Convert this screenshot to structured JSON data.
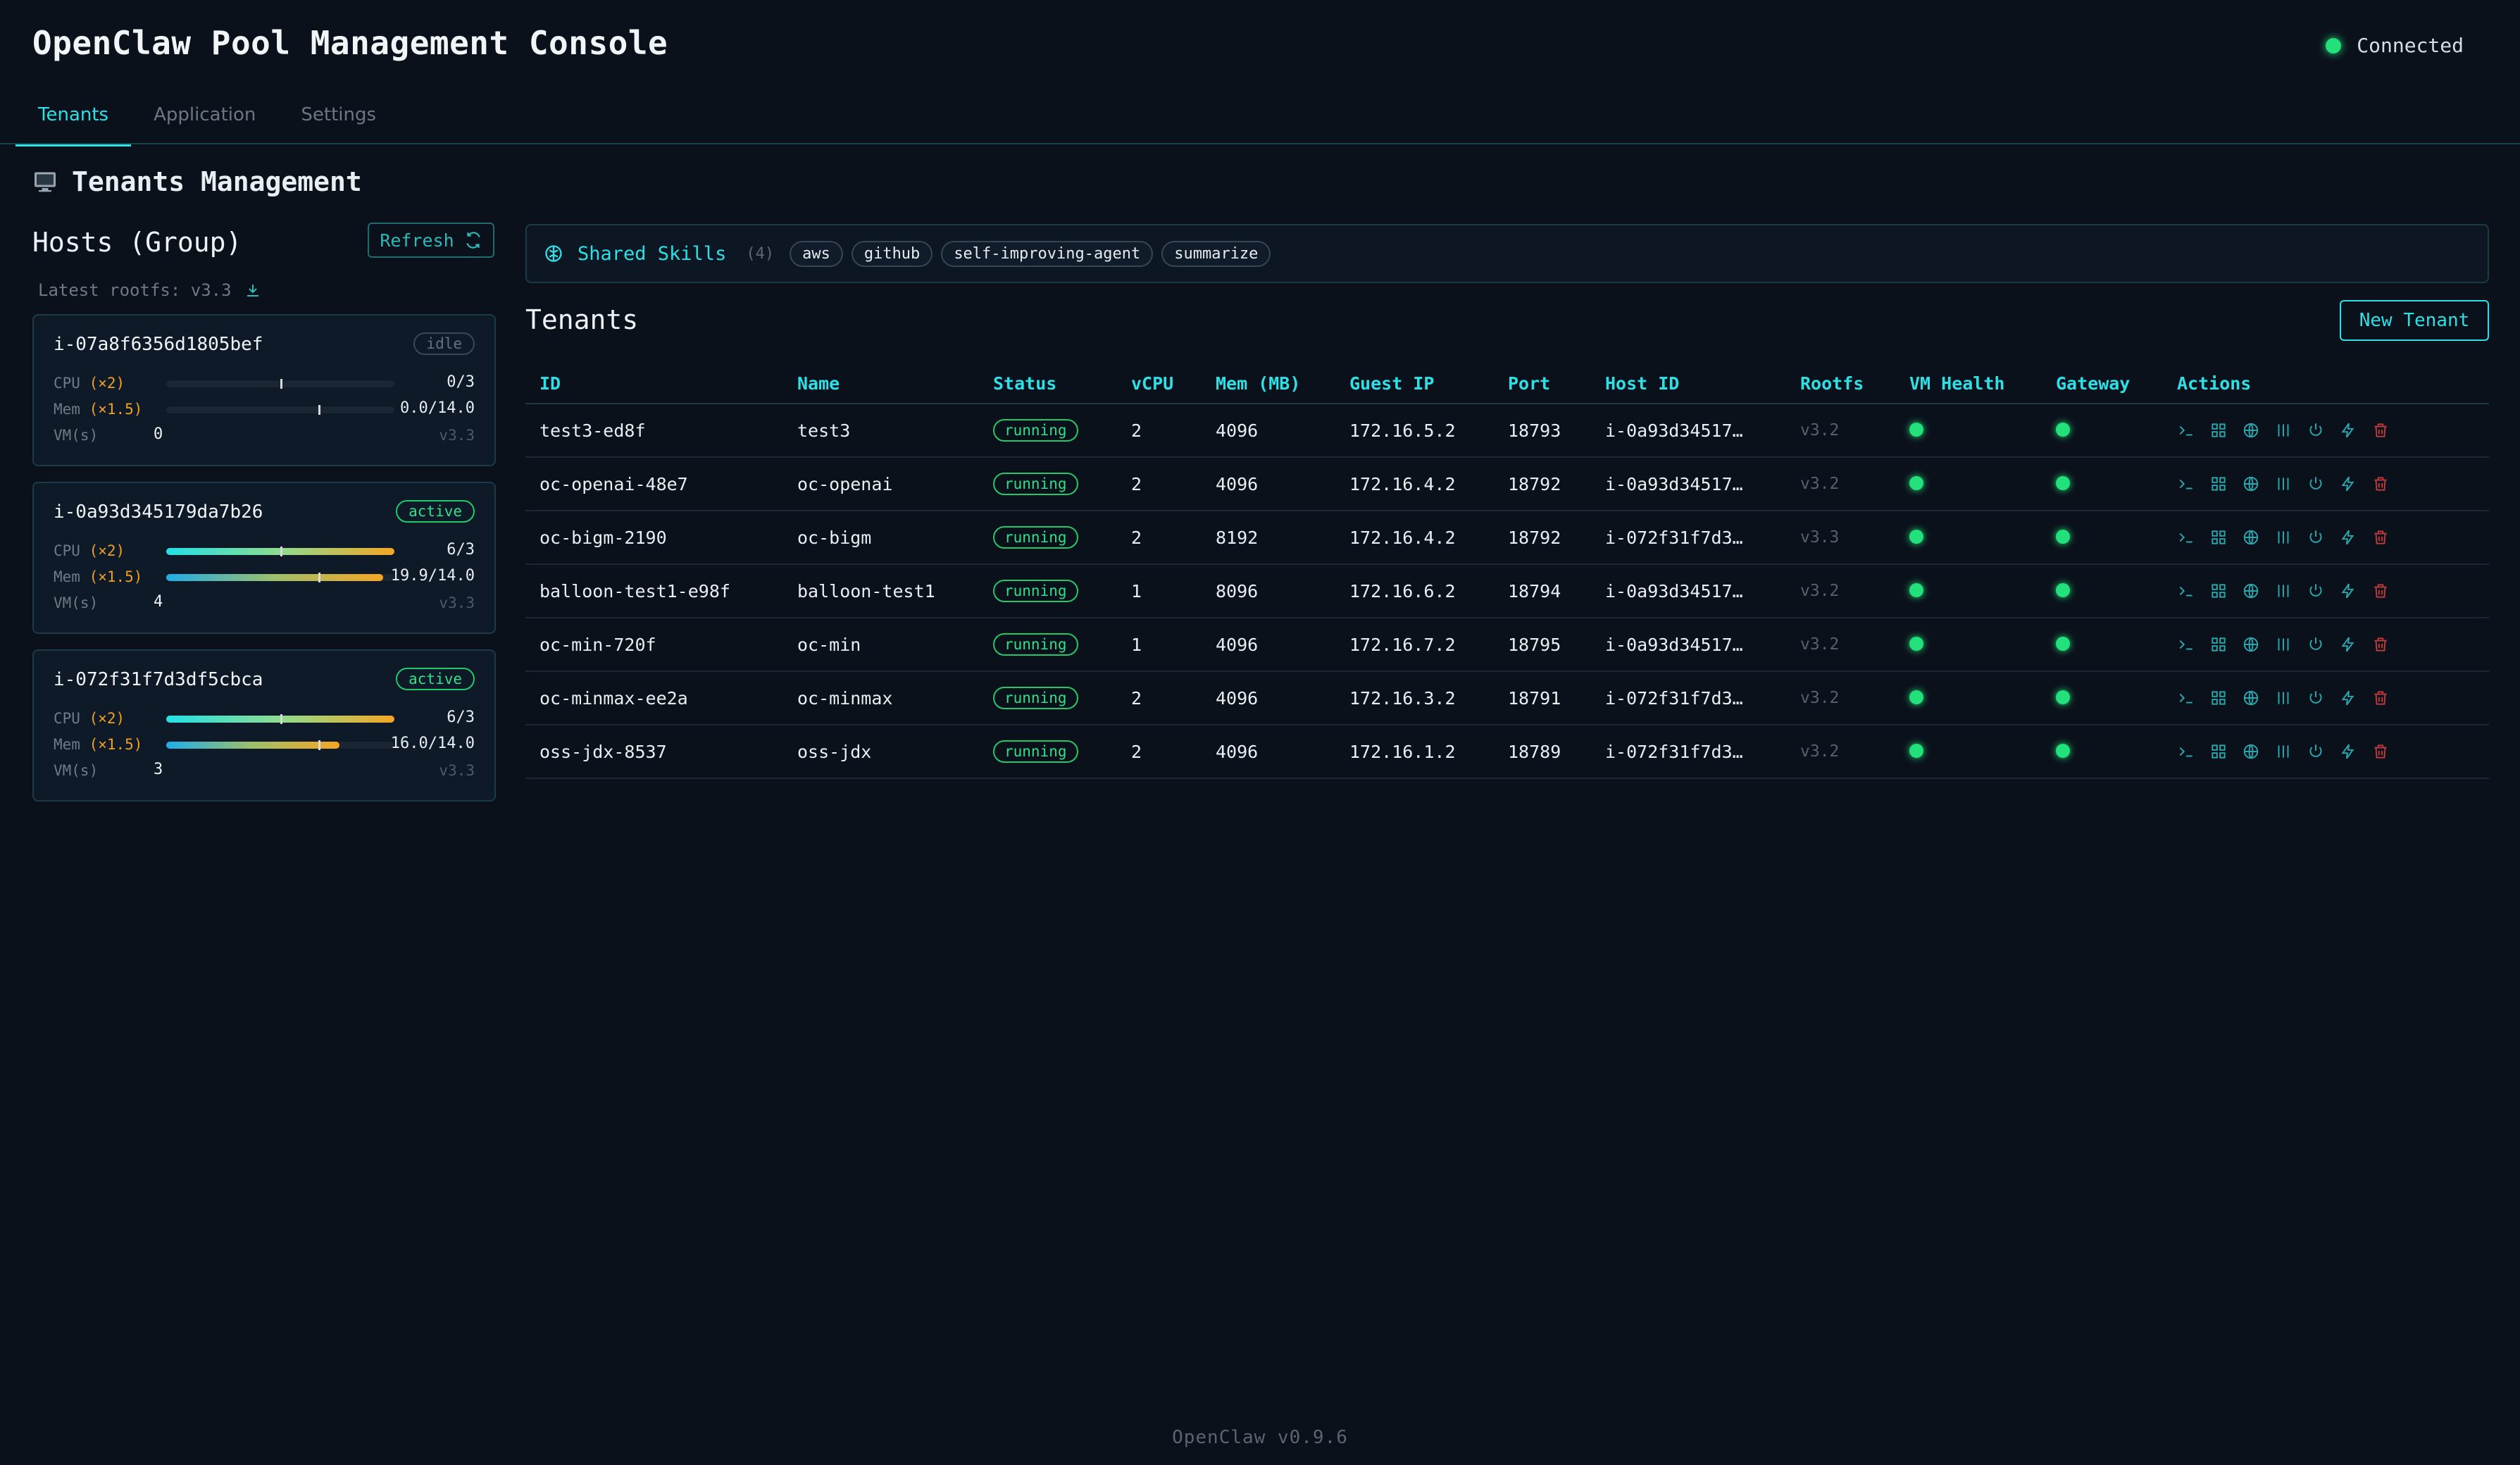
{
  "app": {
    "title": "OpenClaw Pool Management Console",
    "connection_status": "Connected"
  },
  "tabs": [
    {
      "label": "Tenants",
      "active": true
    },
    {
      "label": "Application",
      "active": false
    },
    {
      "label": "Settings",
      "active": false
    }
  ],
  "section": {
    "title": "Tenants Management",
    "icon": "monitor-icon"
  },
  "hosts": {
    "title": "Hosts (Group)",
    "refresh_label": "Refresh",
    "latest_rootfs": "Latest rootfs: v3.3",
    "cpu_label": "CPU",
    "cpu_mult": "(×2)",
    "mem_label": "Mem",
    "mem_mult": "(×1.5)",
    "vm_label": "VM(s)",
    "cards": [
      {
        "id": "i-07a8f6356d1805bef",
        "status": "idle",
        "cpu": "0/3",
        "cpu_fraction": 0.0,
        "mem": "0.0/14.0",
        "mem_fraction": 0.0,
        "vms": "0",
        "version": "v3.3"
      },
      {
        "id": "i-0a93d345179da7b26",
        "status": "active",
        "cpu": "6/3",
        "cpu_fraction": 1.0,
        "mem": "19.9/14.0",
        "mem_fraction": 0.95,
        "vms": "4",
        "version": "v3.3"
      },
      {
        "id": "i-072f31f7d3df5cbca",
        "status": "active",
        "cpu": "6/3",
        "cpu_fraction": 1.0,
        "mem": "16.0/14.0",
        "mem_fraction": 0.76,
        "vms": "3",
        "version": "v3.3"
      }
    ]
  },
  "skills": {
    "label": "Shared Skills",
    "count": "(4)",
    "items": [
      "aws",
      "github",
      "self-improving-agent",
      "summarize"
    ]
  },
  "tenants": {
    "title": "Tenants",
    "new_label": "New Tenant",
    "columns": [
      "ID",
      "Name",
      "Status",
      "vCPU",
      "Mem (MB)",
      "Guest IP",
      "Port",
      "Host ID",
      "Rootfs",
      "VM Health",
      "Gateway",
      "Actions"
    ],
    "rows": [
      {
        "id": "test3-ed8f",
        "name": "test3",
        "status": "running",
        "vcpu": "2",
        "mem": "4096",
        "ip": "172.16.5.2",
        "port": "18793",
        "host": "i-0a93d34517…",
        "rootfs": "v3.2"
      },
      {
        "id": "oc-openai-48e7",
        "name": "oc-openai",
        "status": "running",
        "vcpu": "2",
        "mem": "4096",
        "ip": "172.16.4.2",
        "port": "18792",
        "host": "i-0a93d34517…",
        "rootfs": "v3.2"
      },
      {
        "id": "oc-bigm-2190",
        "name": "oc-bigm",
        "status": "running",
        "vcpu": "2",
        "mem": "8192",
        "ip": "172.16.4.2",
        "port": "18792",
        "host": "i-072f31f7d3…",
        "rootfs": "v3.3"
      },
      {
        "id": "balloon-test1-e98f",
        "name": "balloon-test1",
        "status": "running",
        "vcpu": "1",
        "mem": "8096",
        "ip": "172.16.6.2",
        "port": "18794",
        "host": "i-0a93d34517…",
        "rootfs": "v3.2"
      },
      {
        "id": "oc-min-720f",
        "name": "oc-min",
        "status": "running",
        "vcpu": "1",
        "mem": "4096",
        "ip": "172.16.7.2",
        "port": "18795",
        "host": "i-0a93d34517…",
        "rootfs": "v3.2"
      },
      {
        "id": "oc-minmax-ee2a",
        "name": "oc-minmax",
        "status": "running",
        "vcpu": "2",
        "mem": "4096",
        "ip": "172.16.3.2",
        "port": "18791",
        "host": "i-072f31f7d3…",
        "rootfs": "v3.2"
      },
      {
        "id": "oss-jdx-8537",
        "name": "oss-jdx",
        "status": "running",
        "vcpu": "2",
        "mem": "4096",
        "ip": "172.16.1.2",
        "port": "18789",
        "host": "i-072f31f7d3…",
        "rootfs": "v3.2"
      }
    ],
    "action_icons": [
      "terminal-icon",
      "grid-icon",
      "globe-icon",
      "columns-icon",
      "power-icon",
      "bolt-icon",
      "trash-icon"
    ]
  },
  "footer": "OpenClaw v0.9.6",
  "colors": {
    "background": "#0b111b",
    "accent": "#2de0e6",
    "ok": "#22e07a",
    "warn": "#f5a623",
    "danger": "#e04848"
  }
}
